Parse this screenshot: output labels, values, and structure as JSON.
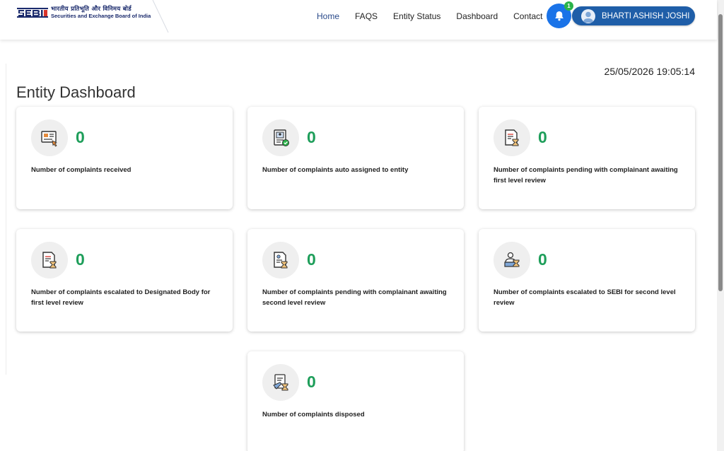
{
  "logo": {
    "mark": "SEBI",
    "hindi": "भारतीय प्रतिभूति और विनिमय बोर्ड",
    "english": "Securities and Exchange Board of India"
  },
  "nav": {
    "items": [
      {
        "label": "Home",
        "active": true
      },
      {
        "label": "FAQS"
      },
      {
        "label": "Entity Status"
      },
      {
        "label": "Dashboard"
      },
      {
        "label": "Contact"
      }
    ]
  },
  "notifications": {
    "count": "1",
    "icon": "bell-icon"
  },
  "user": {
    "name": "BHARTI ASHISH JOSHI",
    "icon": "user-avatar-icon"
  },
  "datetime": "25/05/2026 19:05:14",
  "page_title": "Entity Dashboard",
  "colors": {
    "accent_blue": "#1a73e8",
    "user_button": "#1f5ea8",
    "count_green": "#1e9e5a",
    "badge_green": "#2bb34a"
  },
  "cards": [
    {
      "count": "0",
      "label": "Number of complaints received",
      "icon": "complaint-received-icon"
    },
    {
      "count": "0",
      "label": "Number of complaints auto assigned to entity",
      "icon": "auto-assigned-icon"
    },
    {
      "count": "0",
      "label": "Number of complaints pending with complainant awaiting first level review",
      "icon": "pending-review-icon"
    },
    {
      "count": "0",
      "label": "Number of complaints escalated to Designated Body for first level review",
      "icon": "escalated-designated-body-icon"
    },
    {
      "count": "0",
      "label": "Number of complaints pending with complainant awaiting second level review",
      "icon": "pending-second-review-icon"
    },
    {
      "count": "0",
      "label": "Number of complaints escalated to SEBI for second level review",
      "icon": "escalated-sebi-icon"
    },
    {
      "count": "0",
      "label": "Number of complaints disposed",
      "icon": "disposed-icon"
    }
  ]
}
